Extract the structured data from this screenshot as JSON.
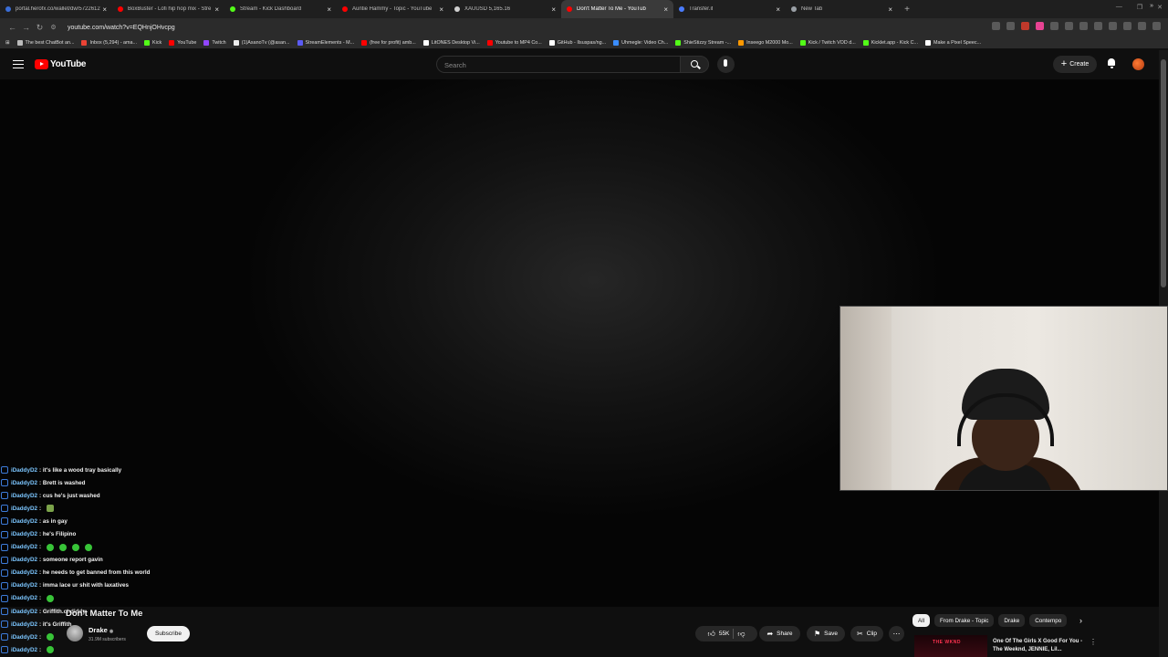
{
  "browser": {
    "tabs": [
      {
        "title": "portal.herofx.co/wallet/dw/5722612",
        "color": "#3a6ed8",
        "active": false
      },
      {
        "title": "BoxBuster - Lofi hip hop mix - Stre",
        "color": "#ff0000",
        "active": false
      },
      {
        "title": "Stream - Kick Dashboard",
        "color": "#53fc18",
        "active": false
      },
      {
        "title": "Auntie Hammy - Topic - YouTube",
        "color": "#ff0000",
        "active": false
      },
      {
        "title": "XAUUSD 5,165.16",
        "color": "#d0d0d0",
        "active": false
      },
      {
        "title": "Don't Matter To Me - YouTub",
        "color": "#ff0000",
        "active": true
      },
      {
        "title": "Transfer.it",
        "color": "#4a7cff",
        "active": false
      },
      {
        "title": "New Tab",
        "color": "#9aa0a6",
        "active": false
      }
    ],
    "url": "youtube.com/watch?v=EQHnjOHvcpg",
    "bookmarks": [
      {
        "label": "The best ChatBot an...",
        "color": "#bbbbbb"
      },
      {
        "label": "Inbox (5,294) - ama...",
        "color": "#ea4335"
      },
      {
        "label": "Kick",
        "color": "#53fc18"
      },
      {
        "label": "YouTube",
        "color": "#ff0000"
      },
      {
        "label": "Twitch",
        "color": "#9146ff"
      },
      {
        "label": "(1)AsanoTv (@asan...",
        "color": "#eeeeee"
      },
      {
        "label": "StreamElements - M...",
        "color": "#5b5bf5"
      },
      {
        "label": "(free for profit) amb...",
        "color": "#ff0000"
      },
      {
        "label": "LitONES Desktop Vi...",
        "color": "#ffffff"
      },
      {
        "label": "Youtube to MP4 Co...",
        "color": "#ff0000"
      },
      {
        "label": "GitHub - Ilsuspas/ng...",
        "color": "#ffffff"
      },
      {
        "label": "Uhmegle: Video Ch...",
        "color": "#3a8dff"
      },
      {
        "label": "ShieStizzy Stream -...",
        "color": "#53fc18"
      },
      {
        "label": "Inseego M2000 Mo...",
        "color": "#ff9900"
      },
      {
        "label": "Kick / Twitch VOD d...",
        "color": "#53fc18"
      },
      {
        "label": "Kicklet.app - Kick C...",
        "color": "#53fc18"
      },
      {
        "label": "Make a Pixel Speec...",
        "color": "#ffffff"
      }
    ]
  },
  "youtube": {
    "logo_text": "YouTube",
    "search_placeholder": "Search",
    "create_label": "Create"
  },
  "chat": {
    "messages": [
      {
        "user": "iDaddyD2",
        "text": ": it's like a wood tray basically",
        "emotes": 0
      },
      {
        "user": "iDaddyD2",
        "text": ": Brett is washed",
        "emotes": 0
      },
      {
        "user": "iDaddyD2",
        "text": ": cus he's just washed",
        "emotes": 0
      },
      {
        "user": "iDaddyD2",
        "text": ":",
        "emotes": 1
      },
      {
        "user": "iDaddyD2",
        "text": ": as in gay",
        "emotes": 0
      },
      {
        "user": "iDaddyD2",
        "text": ": he's Filipino",
        "emotes": 0
      },
      {
        "user": "iDaddyD2",
        "text": ":",
        "emotes": 4
      },
      {
        "user": "iDaddyD2",
        "text": ": someone report gavin",
        "emotes": 0
      },
      {
        "user": "iDaddyD2",
        "text": ": he needs to get banned from this world",
        "emotes": 0
      },
      {
        "user": "iDaddyD2",
        "text": ": imma lace ur shit with laxatives",
        "emotes": 0
      },
      {
        "user": "iDaddyD2",
        "text": ":",
        "emotes": 1
      },
      {
        "user": "iDaddyD2",
        "text": ": Griffith.chdiddy",
        "emotes": 0
      },
      {
        "user": "iDaddyD2",
        "text": ": it's Griffith",
        "emotes": 0
      },
      {
        "user": "iDaddyD2",
        "text": ":",
        "emotes": 1
      },
      {
        "user": "iDaddyD2",
        "text": ":",
        "emotes": 1
      }
    ]
  },
  "video": {
    "title": "Don't Matter To Me",
    "channel": "Drake",
    "subscribers": "31.9M subscribers",
    "subscribe_label": "Subscribe",
    "likes": "55K",
    "share_label": "Share",
    "save_label": "Save",
    "clip_label": "Clip"
  },
  "chips": [
    "All",
    "From Drake - Topic",
    "Drake",
    "Contempo"
  ],
  "recommended": {
    "thumb_text": "THE WKND",
    "title": "One Of The Girls X Good For You - The Weeknd, JENNIE, Lil..."
  }
}
